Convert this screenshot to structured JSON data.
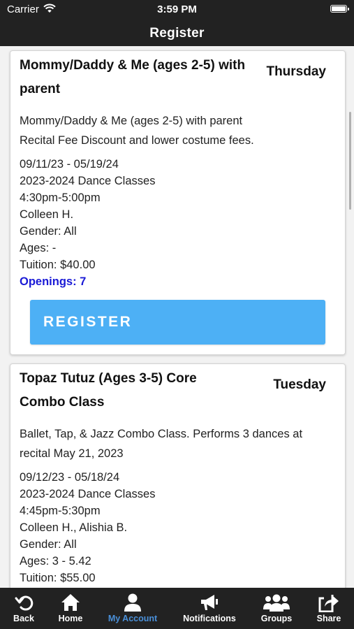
{
  "status_bar": {
    "carrier": "Carrier",
    "time": "3:59 PM"
  },
  "header": {
    "title": "Register"
  },
  "classes": [
    {
      "title": "Mommy/Daddy & Me (ages 2-5) with parent",
      "day": "Thursday",
      "description_1": "Mommy/Daddy & Me (ages 2-5) with parent",
      "description_2": "Recital Fee Discount and lower costume fees.",
      "dates": "09/11/23 - 05/19/24",
      "season": "2023-2024 Dance Classes",
      "time": "4:30pm-5:00pm",
      "instructor": "Colleen H.",
      "gender": "Gender: All",
      "ages": "Ages: -",
      "tuition": "Tuition: $40.00",
      "openings": "Openings: 7",
      "register_label": "REGISTER"
    },
    {
      "title": "Topaz Tutuz (Ages 3-5) Core Combo Class",
      "day": "Tuesday",
      "description_1": "Ballet, Tap, & Jazz Combo Class. Performs 3 dances at recital May 21, 2023",
      "dates": "09/12/23 - 05/18/24",
      "season": "2023-2024 Dance Classes",
      "time": "4:45pm-5:30pm",
      "instructor": "Colleen H., Alishia B.",
      "gender": "Gender: All",
      "ages": "Ages: 3 - 5.42",
      "tuition": "Tuition: $55.00"
    }
  ],
  "tab_bar": {
    "items": [
      {
        "label": "Back",
        "icon": "back-arrow-icon"
      },
      {
        "label": "Home",
        "icon": "home-icon"
      },
      {
        "label": "My Account",
        "icon": "user-icon",
        "active": true
      },
      {
        "label": "Notifications",
        "icon": "megaphone-icon"
      },
      {
        "label": "Groups",
        "icon": "group-icon"
      },
      {
        "label": "Share",
        "icon": "share-icon"
      }
    ],
    "active_color": "#4a90d9"
  },
  "colors": {
    "bar_background": "#222222",
    "register_button": "#4db0f5",
    "openings_text": "#1a1ad6"
  }
}
